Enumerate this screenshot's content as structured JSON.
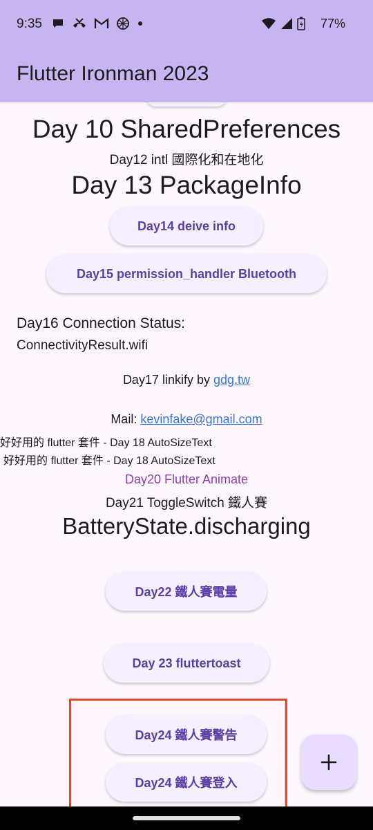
{
  "status": {
    "time": "9:35",
    "battery": "77%",
    "left_icons": [
      "chat-icon",
      "missed-call-icon",
      "gmail-icon",
      "globe-icon",
      "dot-icon"
    ],
    "right_icons": [
      "wifi-icon",
      "signal-icon",
      "battery-icon"
    ]
  },
  "appbar": {
    "title": "Flutter Ironman 2023"
  },
  "content": {
    "day10": "Day 10 SharedPreferences",
    "day12": "Day12 intl 國際化和在地化",
    "day13": "Day 13 PackageInfo",
    "day14_button": "Day14 deive info",
    "day15_button": "Day15 permission_handler Bluetooth",
    "day16_title": "Day16 Connection Status:",
    "day16_value": "ConnectivityResult.wifi",
    "day17_prefix": "Day17 linkify by ",
    "day17_link": "gdg.tw",
    "mail_prefix": "Mail: ",
    "mail_link": "kevinfake@gmail.com",
    "autosize_1": "好好用的 flutter 套件 - Day 18 AutoSizeText",
    "autosize_2": "好好用的 flutter 套件 - Day 18 AutoSizeText",
    "day20": "Day20 Flutter Animate",
    "day21": "Day21 ToggleSwitch 鐵人賽",
    "battery_state": "BatteryState.discharging",
    "day22_button": "Day22 鐵人賽電量",
    "day23_button": "Day 23 fluttertoast",
    "day24_alert_button": "Day24 鐵人賽警告",
    "day24_login_button": "Day24 鐵人賽登入"
  },
  "fab": {
    "icon": "plus-icon"
  },
  "colors": {
    "appbar": "#c6b5f1",
    "background": "#fef7ff",
    "button_text": "#5b3fa8",
    "link": "#3b78d8",
    "animate_text": "#8e3fb0",
    "highlight": "#e0492f"
  }
}
